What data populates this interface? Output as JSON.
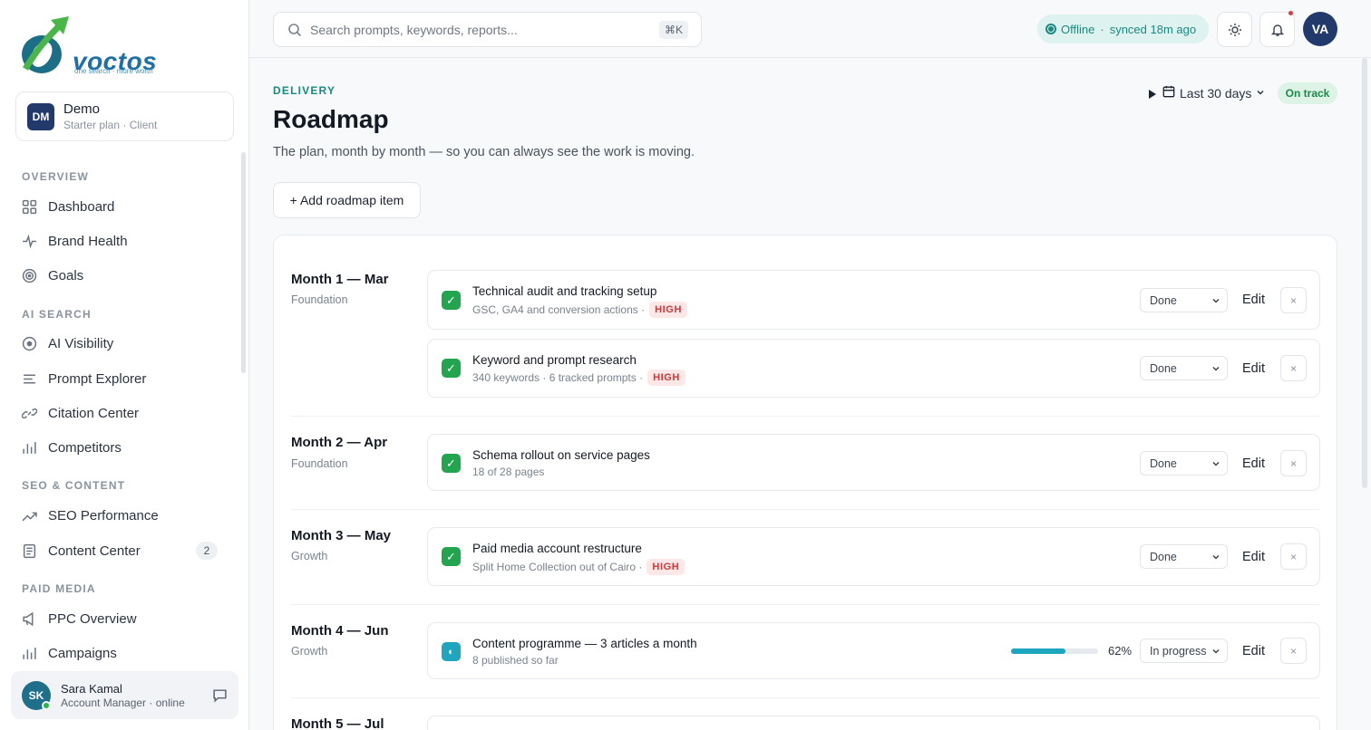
{
  "brand": {
    "name": "voctos",
    "tagline": "one search · more worth"
  },
  "workspace": {
    "initials": "DM",
    "name": "Demo",
    "plan": "Starter plan · Client"
  },
  "sidebar": {
    "sections": [
      {
        "label": "OVERVIEW"
      },
      {
        "label": "AI SEARCH"
      },
      {
        "label": "SEO & CONTENT"
      },
      {
        "label": "PAID MEDIA"
      }
    ],
    "items": [
      {
        "label": "Dashboard",
        "icon": "grid-icon"
      },
      {
        "label": "Brand Health",
        "icon": "pulse-icon"
      },
      {
        "label": "Goals",
        "icon": "target-icon"
      },
      {
        "label": "AI Visibility",
        "icon": "eye-icon"
      },
      {
        "label": "Prompt Explorer",
        "icon": "list-icon"
      },
      {
        "label": "Citation Center",
        "icon": "link-icon"
      },
      {
        "label": "Competitors",
        "icon": "bar-chart-icon"
      },
      {
        "label": "SEO Performance",
        "icon": "trend-up-icon"
      },
      {
        "label": "Content Center",
        "icon": "document-icon",
        "badge": "2"
      },
      {
        "label": "PPC Overview",
        "icon": "megaphone-icon"
      },
      {
        "label": "Campaigns",
        "icon": "bar-chart-icon"
      }
    ]
  },
  "user": {
    "initials": "SK",
    "name": "Sara Kamal",
    "role": "Account Manager · online"
  },
  "topbar": {
    "search_placeholder": "Search prompts, keywords, reports...",
    "shortcut": "⌘K",
    "status_state": "Offline",
    "status_sync": "synced 18m ago",
    "avatar_initials": "VA"
  },
  "header": {
    "eyebrow": "DELIVERY",
    "title": "Roadmap",
    "subtitle": "The plan, month by month — so you can always see the work is moving.",
    "range_label": "Last 30 days",
    "status_badge": "On track",
    "add_button": "+ Add roadmap item"
  },
  "labels": {
    "edit": "Edit",
    "remove": "×"
  },
  "months": [
    {
      "title": "Month 1 — Mar",
      "phase": "Foundation"
    },
    {
      "title": "Month 2 — Apr",
      "phase": "Foundation"
    },
    {
      "title": "Month 3 — May",
      "phase": "Growth"
    },
    {
      "title": "Month 4 — Jun",
      "phase": "Growth"
    },
    {
      "title": "Month 5 — Jul",
      "phase": ""
    }
  ],
  "items": [
    {
      "title": "Technical audit and tracking setup",
      "meta": "GSC, GA4 and conversion actions ·",
      "priority": "HIGH",
      "status": "Done"
    },
    {
      "title": "Keyword and prompt research",
      "meta": "340 keywords · 6 tracked prompts ·",
      "priority": "HIGH",
      "status": "Done"
    },
    {
      "title": "Schema rollout on service pages",
      "meta": "18 of 28 pages",
      "priority": "",
      "status": "Done"
    },
    {
      "title": "Paid media account restructure",
      "meta": "Split Home Collection out of Cairo ·",
      "priority": "HIGH",
      "status": "Done"
    },
    {
      "title": "Content programme — 3 articles a month",
      "meta": "8 published so far",
      "priority": "",
      "status": "In progress",
      "progress": 62,
      "progress_label": "62%"
    }
  ],
  "colors": {
    "accent": "#1a8a80",
    "done": "#23a550",
    "progress": "#1ea6be",
    "priority_high": "#d03838",
    "brand_navy": "#22396b"
  }
}
